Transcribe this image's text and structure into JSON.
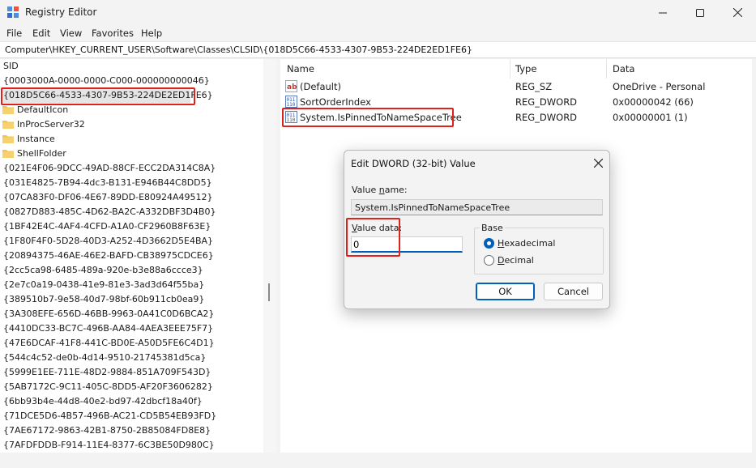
{
  "window": {
    "title": "Registry Editor"
  },
  "menu": [
    "File",
    "Edit",
    "View",
    "Favorites",
    "Help"
  ],
  "address": "Computer\\HKEY_CURRENT_USER\\Software\\Classes\\CLSID\\{018D5C66-4533-4307-9B53-224DE2ED1FE6}",
  "tree": {
    "items": [
      {
        "label": "SID",
        "folder": false
      },
      {
        "label": "{0003000A-0000-0000-C000-000000000046}",
        "folder": false
      },
      {
        "label": "{018D5C66-4533-4307-9B53-224DE2ED1FE6}",
        "folder": false,
        "selected": true
      },
      {
        "label": "DefaultIcon",
        "folder": true
      },
      {
        "label": "InProcServer32",
        "folder": true
      },
      {
        "label": "Instance",
        "folder": true
      },
      {
        "label": "ShellFolder",
        "folder": true
      },
      {
        "label": "{021E4F06-9DCC-49AD-88CF-ECC2DA314C8A}",
        "folder": false
      },
      {
        "label": "{031E4825-7B94-4dc3-B131-E946B44C8DD5}",
        "folder": false
      },
      {
        "label": "{07CA83F0-DF06-4E67-89DD-E80924A49512}",
        "folder": false
      },
      {
        "label": "{0827D883-485C-4D62-BA2C-A332DBF3D4B0}",
        "folder": false
      },
      {
        "label": "{1BF42E4C-4AF4-4CFD-A1A0-CF2960B8F63E}",
        "folder": false
      },
      {
        "label": "{1F80F4F0-5D28-40D3-A252-4D3662D5E4BA}",
        "folder": false
      },
      {
        "label": "{20894375-46AE-46E2-BAFD-CB38975CDCE6}",
        "folder": false
      },
      {
        "label": "{2cc5ca98-6485-489a-920e-b3e88a6ccce3}",
        "folder": false
      },
      {
        "label": "{2e7c0a19-0438-41e9-81e3-3ad3d64f55ba}",
        "folder": false
      },
      {
        "label": "{389510b7-9e58-40d7-98bf-60b911cb0ea9}",
        "folder": false
      },
      {
        "label": "{3A308EFE-656D-46BB-9963-0A41C0D6BCA2}",
        "folder": false
      },
      {
        "label": "{4410DC33-BC7C-496B-AA84-4AEA3EEE75F7}",
        "folder": false
      },
      {
        "label": "{47E6DCAF-41F8-441C-BD0E-A50D5FE6C4D1}",
        "folder": false
      },
      {
        "label": "{544c4c52-de0b-4d14-9510-21745381d5ca}",
        "folder": false
      },
      {
        "label": "{5999E1EE-711E-48D2-9884-851A709F543D}",
        "folder": false
      },
      {
        "label": "{5AB7172C-9C11-405C-8DD5-AF20F3606282}",
        "folder": false
      },
      {
        "label": "{6bb93b4e-44d8-40e2-bd97-42dbcf18a40f}",
        "folder": false
      },
      {
        "label": "{71DCE5D6-4B57-496B-AC21-CD5B54EB93FD}",
        "folder": false
      },
      {
        "label": "{7AE67172-9863-42B1-8750-2B85084FD8E8}",
        "folder": false
      },
      {
        "label": "{7AFDFDDB-F914-11E4-8377-6C3BE50D980C}",
        "folder": false
      }
    ]
  },
  "list": {
    "columns": [
      "Name",
      "Type",
      "Data"
    ],
    "rows": [
      {
        "name": "(Default)",
        "type": "REG_SZ",
        "data": "OneDrive - Personal",
        "icon": "string-value-icon"
      },
      {
        "name": "SortOrderIndex",
        "type": "REG_DWORD",
        "data": "0x00000042 (66)",
        "icon": "binary-value-icon"
      },
      {
        "name": "System.IsPinnedToNameSpaceTree",
        "type": "REG_DWORD",
        "data": "0x00000001 (1)",
        "icon": "binary-value-icon"
      }
    ]
  },
  "dialog": {
    "title": "Edit DWORD (32-bit) Value",
    "value_name_label_prefix": "Value ",
    "value_name_label_hot": "n",
    "value_name_label_suffix": "ame:",
    "value_name": "System.IsPinnedToNameSpaceTree",
    "value_data_label_prefix": "",
    "value_data_label_hot": "V",
    "value_data_label_suffix": "alue data:",
    "value_data": "0",
    "base_label": "Base",
    "hex_hot": "H",
    "hex_rest": "exadecimal",
    "dec_hot": "D",
    "dec_rest": "ecimal",
    "ok_label": "OK",
    "cancel_label": "Cancel"
  },
  "colors": {
    "highlight": "#e0201b",
    "accent": "#005fb8",
    "folder": "#f4c34f"
  }
}
